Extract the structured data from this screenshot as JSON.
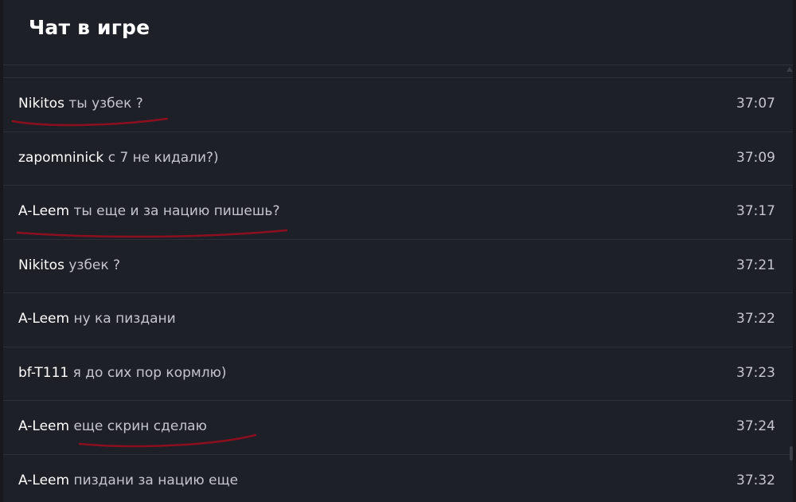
{
  "header": {
    "title": "Чат в игре"
  },
  "messages": [
    {
      "author": "Nikitos",
      "text": "ты узбек ?",
      "time": "37:07",
      "underlined": true
    },
    {
      "author": "zapomninick",
      "text": "с 7 не кидали?)",
      "time": "37:09",
      "underlined": false
    },
    {
      "author": "A-Leem",
      "text": "ты еще и за нацию пишешь?",
      "time": "37:17",
      "underlined": true
    },
    {
      "author": "Nikitos",
      "text": "узбек ?",
      "time": "37:21",
      "underlined": false
    },
    {
      "author": "A-Leem",
      "text": "ну ка пиздани",
      "time": "37:22",
      "underlined": false
    },
    {
      "author": "bf-T111",
      "text": "я до сих пор кормлю)",
      "time": "37:23",
      "underlined": false
    },
    {
      "author": "A-Leem",
      "text": "еще скрин сделаю",
      "time": "37:24",
      "underlined": true
    },
    {
      "author": "A-Leem",
      "text": "пиздани за нацию еще",
      "time": "37:32",
      "underlined": false
    }
  ],
  "colors": {
    "background": "#1e2027",
    "author": "#ffffff",
    "message": "#c4c6cc",
    "annotation": "#8b0f1e"
  }
}
